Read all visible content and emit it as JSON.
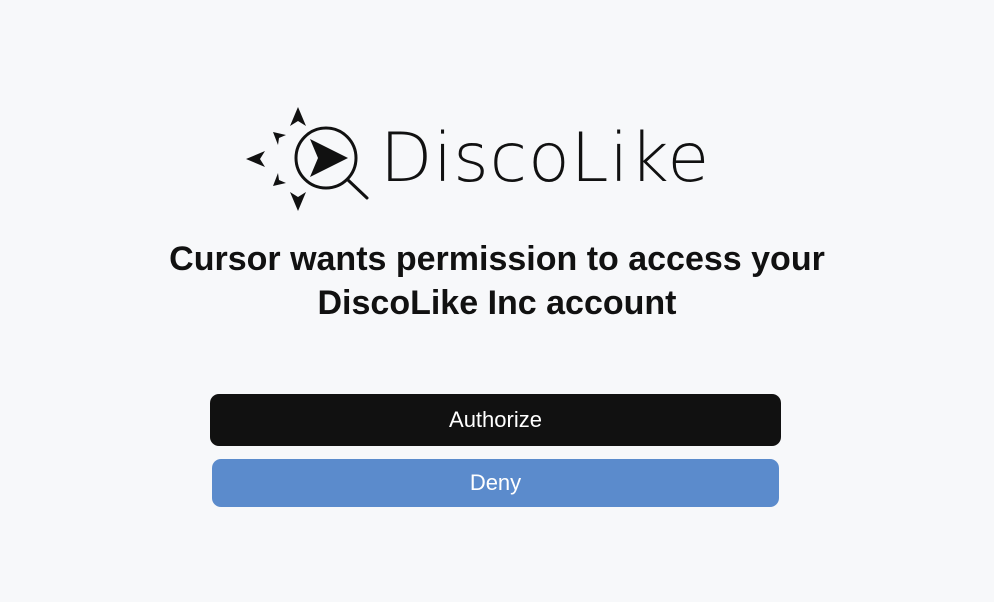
{
  "brand": {
    "logo_text": "DiscoLike",
    "logo_icon": "compass-magnifier-icon",
    "color": "#111111"
  },
  "prompt": {
    "line1": "Cursor wants permission to access your",
    "line2": "DiscoLike Inc account"
  },
  "actions": {
    "authorize_label": "Authorize",
    "authorize_color": "#111111",
    "deny_label": "Deny",
    "deny_color": "#5b8bcc"
  },
  "background_color": "#f7f8fa"
}
